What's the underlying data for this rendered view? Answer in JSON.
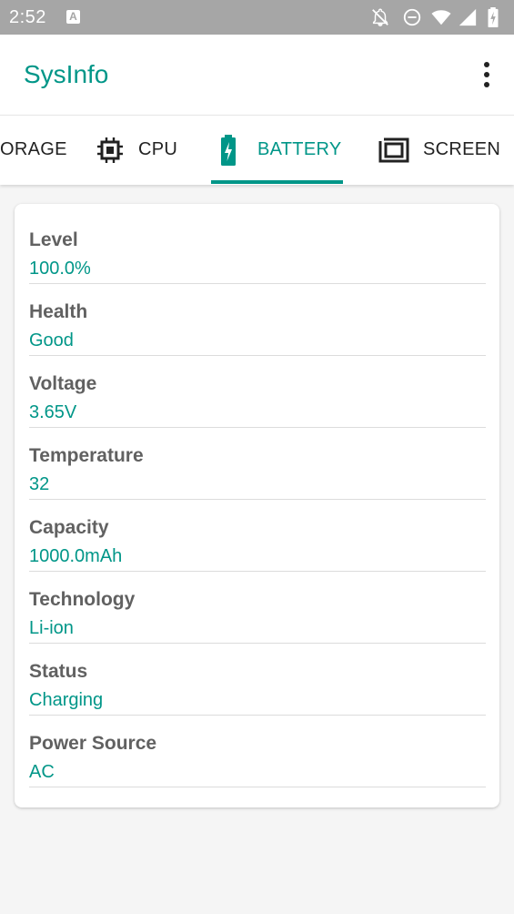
{
  "status_bar": {
    "time": "2:52",
    "notification_icon": "A",
    "icons": [
      "notifications-off-icon",
      "do-not-disturb-icon",
      "wifi-icon",
      "cell-signal-icon",
      "battery-charging-icon"
    ]
  },
  "app_bar": {
    "title": "SysInfo",
    "menu_icon": "more-vert-icon"
  },
  "tabs": [
    {
      "label": "ORAGE",
      "icon": "storage-icon",
      "active": false
    },
    {
      "label": "CPU",
      "icon": "cpu-chip-icon",
      "active": false
    },
    {
      "label": "BATTERY",
      "icon": "battery-charging-icon",
      "active": true
    },
    {
      "label": "SCREEN",
      "icon": "screen-icon",
      "active": false
    }
  ],
  "battery_info": [
    {
      "label": "Level",
      "value": "100.0%"
    },
    {
      "label": "Health",
      "value": "Good"
    },
    {
      "label": "Voltage",
      "value": "3.65V"
    },
    {
      "label": "Temperature",
      "value": "32"
    },
    {
      "label": "Capacity",
      "value": "1000.0mAh"
    },
    {
      "label": "Technology",
      "value": "Li-ion"
    },
    {
      "label": "Status",
      "value": "Charging"
    },
    {
      "label": "Power Source",
      "value": "AC"
    }
  ],
  "colors": {
    "accent": "#009688",
    "status_bar": "#a6a6a6",
    "label_text": "#616161",
    "background": "#f5f5f5"
  }
}
